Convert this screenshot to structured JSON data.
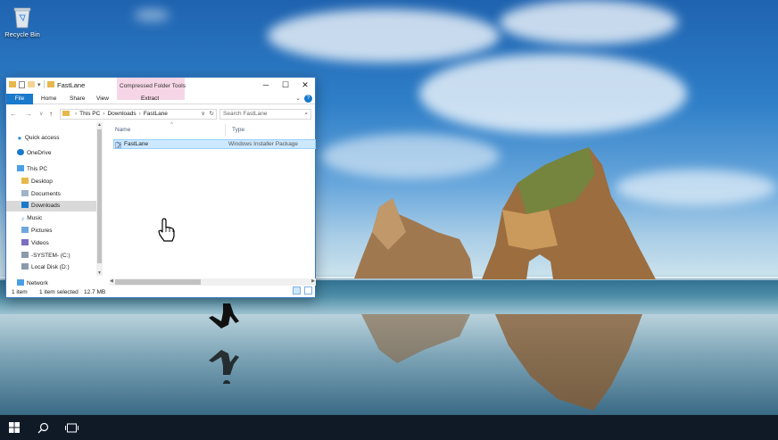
{
  "desktop": {
    "recycle_bin_label": "Recycle Bin"
  },
  "window": {
    "title": "FastLane",
    "contextual_tab_group": "Compressed Folder Tools",
    "ribbon_tabs": [
      "File",
      "Home",
      "Share",
      "View",
      "Extract"
    ],
    "address": {
      "crumbs": [
        "This PC",
        "Downloads",
        "FastLane"
      ]
    },
    "search_placeholder": "Search FastLane",
    "nav": {
      "items": [
        {
          "label": "Quick access",
          "icon": "star-icon"
        },
        {
          "label": "OneDrive",
          "icon": "cloud-icon"
        },
        {
          "label": "This PC",
          "icon": "computer-icon"
        },
        {
          "label": "Desktop",
          "icon": "folder-icon"
        },
        {
          "label": "Documents",
          "icon": "folder-icon"
        },
        {
          "label": "Downloads",
          "icon": "download-icon"
        },
        {
          "label": "Music",
          "icon": "music-icon"
        },
        {
          "label": "Pictures",
          "icon": "pictures-icon"
        },
        {
          "label": "Videos",
          "icon": "videos-icon"
        },
        {
          "label": "-SYSTEM- (C:)",
          "icon": "drive-icon"
        },
        {
          "label": "Local Disk (D:)",
          "icon": "drive-icon"
        },
        {
          "label": "Network",
          "icon": "network-icon"
        }
      ],
      "selected": "Downloads"
    },
    "columns": {
      "name": "Name",
      "type": "Type"
    },
    "files": [
      {
        "name": "FastLane",
        "type": "Windows Installer Package",
        "icon": "installer-icon"
      }
    ],
    "status": {
      "count": "1 item",
      "selection": "1 item selected",
      "size": "12.7 MB"
    }
  },
  "colors": {
    "accent": "#1979ca",
    "selection": "#cce8ff",
    "contextual_tab": "#f6d6e6",
    "taskbar": "#101a27"
  }
}
